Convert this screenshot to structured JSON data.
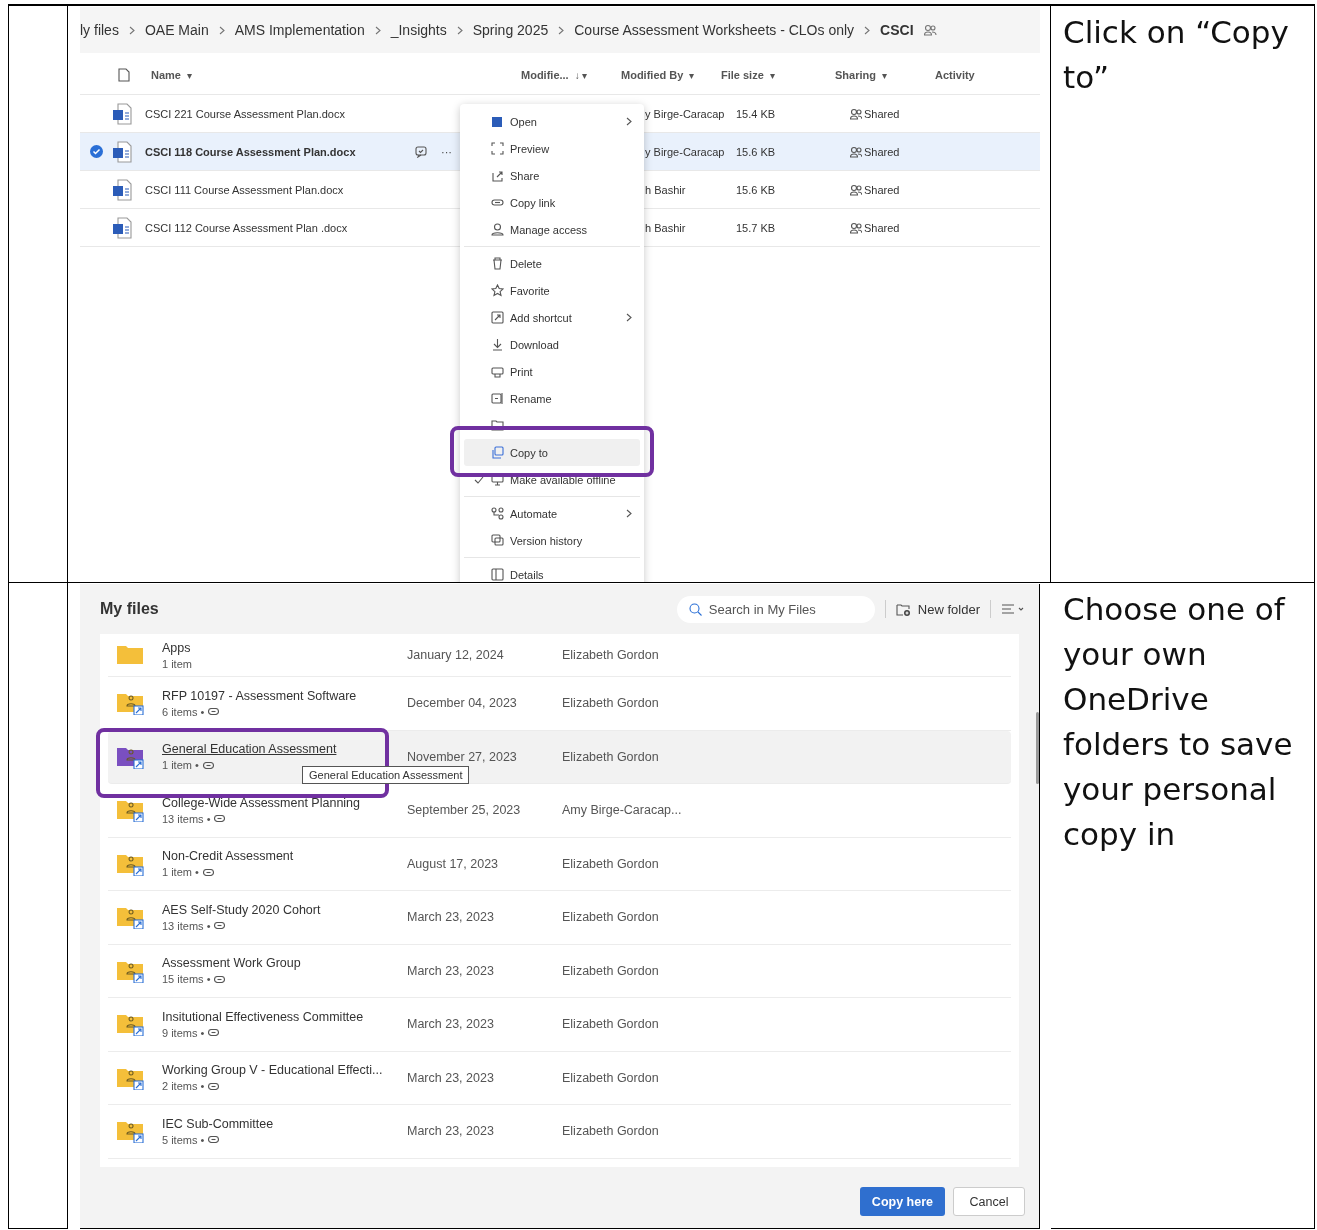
{
  "steps": [
    {
      "kind": "browser",
      "instruction": "Click on “Copy to”",
      "browser": {
        "breadcrumbs": [
          {
            "label": "ly files",
            "current": false
          },
          {
            "label": "OAE Main",
            "current": false
          },
          {
            "label": "AMS Implementation",
            "current": false
          },
          {
            "label": "_Insights",
            "current": false
          },
          {
            "label": "Spring 2025",
            "current": false
          },
          {
            "label": "Course Assessment Worksheets - CLOs only",
            "current": false
          },
          {
            "label": "CSCI",
            "current": true
          }
        ],
        "columns": [
          {
            "label": "Name",
            "sort": "▾"
          },
          {
            "label": "Modifie...",
            "sort": "↓ ▾"
          },
          {
            "label": "Modified By",
            "sort": "▾"
          },
          {
            "label": "File size",
            "sort": "▾"
          },
          {
            "label": "Sharing",
            "sort": "▾"
          },
          {
            "label": "Activity"
          }
        ],
        "files": [
          {
            "name": "CSCI 221 Course Assessment Plan.docx",
            "modified_by": "y Birge-Caracap",
            "size": "15.4 KB",
            "sharing": "Shared",
            "selected": false
          },
          {
            "name": "CSCI 118 Course Assessment Plan.docx",
            "modified_by": "y Birge-Caracap",
            "size": "15.6 KB",
            "sharing": "Shared",
            "selected": true,
            "more_button": "···"
          },
          {
            "name": "CSCI 111 Course Assessment Plan.docx",
            "modified_by": "h Bashir",
            "size": "15.6 KB",
            "sharing": "Shared",
            "selected": false
          },
          {
            "name": "CSCI 112 Course Assessment Plan .docx",
            "modified_by": "h Bashir",
            "size": "15.7 KB",
            "sharing": "Shared",
            "selected": false
          }
        ],
        "menu": [
          {
            "kind": "item",
            "label": "Open",
            "submenu": true,
            "checked": false,
            "selected": false
          },
          {
            "kind": "item",
            "label": "Preview",
            "submenu": false,
            "checked": false,
            "selected": false
          },
          {
            "kind": "item",
            "label": "Share",
            "submenu": false,
            "checked": false,
            "selected": false
          },
          {
            "kind": "item",
            "label": "Copy link",
            "submenu": false,
            "checked": false,
            "selected": false
          },
          {
            "kind": "item",
            "label": "Manage access",
            "submenu": false,
            "checked": false,
            "selected": false
          },
          {
            "kind": "divider"
          },
          {
            "kind": "item",
            "label": "Delete",
            "submenu": false,
            "checked": false,
            "selected": false
          },
          {
            "kind": "item",
            "label": "Favorite",
            "submenu": false,
            "checked": false,
            "selected": false
          },
          {
            "kind": "item",
            "label": "Add shortcut",
            "submenu": true,
            "checked": false,
            "selected": false
          },
          {
            "kind": "item",
            "label": "Download",
            "submenu": false,
            "checked": false,
            "selected": false
          },
          {
            "kind": "item",
            "label": "Print",
            "submenu": false,
            "checked": false,
            "selected": false
          },
          {
            "kind": "item",
            "label": "Rename",
            "submenu": false,
            "checked": false,
            "selected": false
          },
          {
            "kind": "obscured"
          },
          {
            "kind": "item",
            "label": "Copy to",
            "submenu": false,
            "checked": false,
            "selected": true
          },
          {
            "kind": "item",
            "label": "Make available offline",
            "submenu": false,
            "checked": true,
            "selected": false
          },
          {
            "kind": "divider"
          },
          {
            "kind": "item",
            "label": "Automate",
            "submenu": true,
            "checked": false,
            "selected": false
          },
          {
            "kind": "item",
            "label": "Version history",
            "submenu": false,
            "checked": false,
            "selected": false
          },
          {
            "kind": "divider"
          },
          {
            "kind": "item",
            "label": "Details",
            "submenu": false,
            "checked": false,
            "selected": false
          }
        ]
      }
    },
    {
      "kind": "dialog",
      "instruction": "Choose one of your own OneDrive folders to save your personal copy in",
      "dialog": {
        "title": "My files",
        "search": {
          "placeholder": "Search in My Files"
        },
        "new_folder": "New folder",
        "folders": [
          {
            "name": "Apps",
            "meta": "1 item",
            "date": "January 12, 2024",
            "owner": "Elizabeth Gordon",
            "shared": false,
            "color": "#f4bf3a",
            "selected": false
          },
          {
            "name": "RFP 10197 - Assessment Software",
            "meta": "6 items •",
            "date": "December 04, 2023",
            "owner": "Elizabeth Gordon",
            "shared": true,
            "color": "#f4bf3a",
            "selected": false
          },
          {
            "name": "General Education Assessment",
            "meta": "1 item •",
            "date": "November 27, 2023",
            "owner": "Elizabeth Gordon",
            "shared": true,
            "color": "#7a4fc0",
            "selected": true,
            "tooltip": "General Education Assessment"
          },
          {
            "name": "College-Wide Assessment Planning",
            "meta": "13 items •",
            "date": "September 25, 2023",
            "owner": "Amy Birge-Caracap...",
            "shared": true,
            "color": "#f4bf3a",
            "selected": false
          },
          {
            "name": "Non-Credit Assessment",
            "meta": "1 item •",
            "date": "August 17, 2023",
            "owner": "Elizabeth Gordon",
            "shared": true,
            "color": "#f4bf3a",
            "selected": false
          },
          {
            "name": "AES Self-Study 2020 Cohort",
            "meta": "13 items •",
            "date": "March 23, 2023",
            "owner": "Elizabeth Gordon",
            "shared": true,
            "color": "#f4bf3a",
            "selected": false
          },
          {
            "name": "Assessment Work Group",
            "meta": "15 items •",
            "date": "March 23, 2023",
            "owner": "Elizabeth Gordon",
            "shared": true,
            "color": "#f4bf3a",
            "selected": false
          },
          {
            "name": "Insitutional Effectiveness Committee",
            "meta": "9 items •",
            "date": "March 23, 2023",
            "owner": "Elizabeth Gordon",
            "shared": true,
            "color": "#f4bf3a",
            "selected": false
          },
          {
            "name": "Working Group V - Educational Effecti...",
            "meta": "2 items •",
            "date": "March 23, 2023",
            "owner": "Elizabeth Gordon",
            "shared": true,
            "color": "#f4bf3a",
            "selected": false
          },
          {
            "name": "IEC Sub-Committee",
            "meta": "5 items •",
            "date": "March 23, 2023",
            "owner": "Elizabeth Gordon",
            "shared": true,
            "color": "#f4bf3a",
            "selected": false
          }
        ],
        "buttons": [
          {
            "label": "Copy here",
            "kind": "primary"
          },
          {
            "label": "Cancel",
            "kind": "secondary"
          }
        ]
      }
    }
  ]
}
